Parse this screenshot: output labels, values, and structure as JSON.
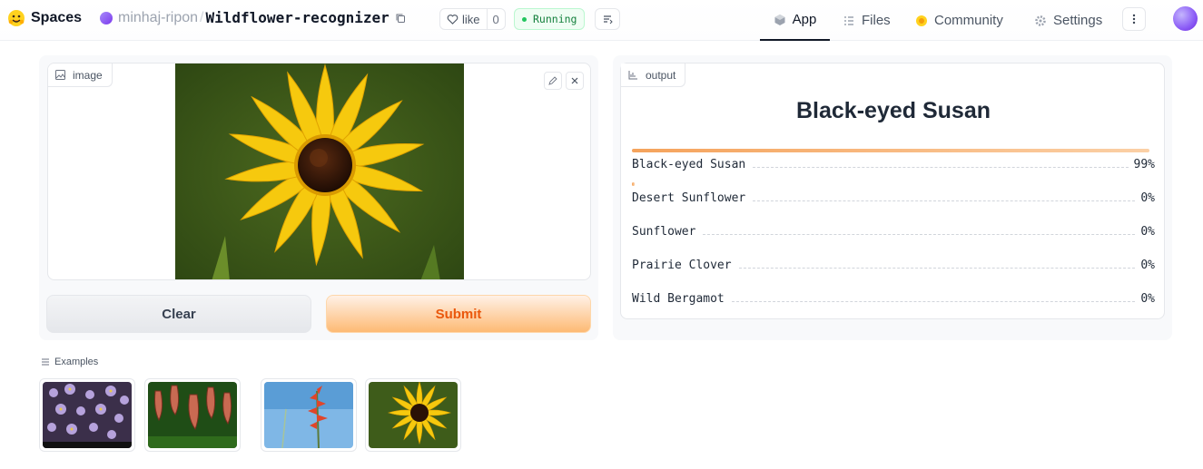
{
  "header": {
    "brand": "Spaces",
    "owner": "minhaj-ripon",
    "separator": "/",
    "space_name": "Wildflower-recognizer",
    "like_label": "like",
    "like_count": "0",
    "status": "Running",
    "nav": {
      "app": "App",
      "files": "Files",
      "community": "Community",
      "settings": "Settings"
    }
  },
  "input": {
    "label": "image",
    "clear_label": "Clear",
    "submit_label": "Submit"
  },
  "output": {
    "label": "output",
    "top_prediction": "Black-eyed Susan",
    "confidences": [
      {
        "label": "Black-eyed Susan",
        "value": "99%",
        "fraction": 0.99
      },
      {
        "label": "Desert Sunflower",
        "value": "0%",
        "fraction": 0.003
      },
      {
        "label": "Sunflower",
        "value": "0%",
        "fraction": 0
      },
      {
        "label": "Prairie Clover",
        "value": "0%",
        "fraction": 0
      },
      {
        "label": "Wild Bergamot",
        "value": "0%",
        "fraction": 0
      }
    ]
  },
  "examples": {
    "label": "Examples"
  },
  "colors": {
    "accent_orange": "#ea580c",
    "running_green": "#15803d",
    "bar_orange": "#f5a35c"
  }
}
